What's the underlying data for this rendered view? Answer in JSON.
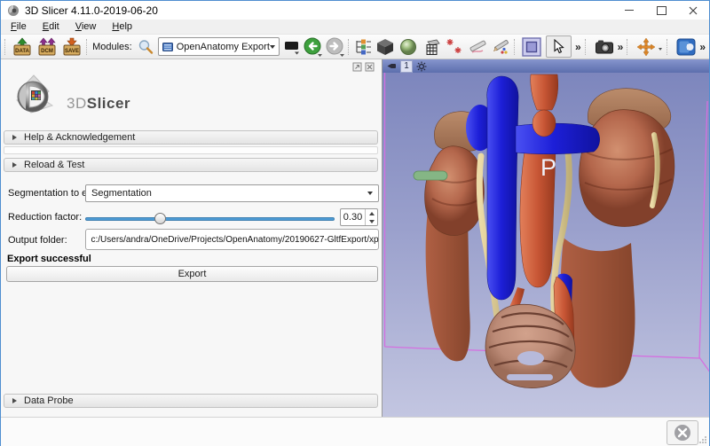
{
  "window": {
    "title": "3D Slicer 4.11.0-2019-06-20"
  },
  "menu": {
    "items": [
      "File",
      "Edit",
      "View",
      "Help"
    ]
  },
  "toolbar": {
    "modules_label": "Modules:",
    "module_value": "OpenAnatomy Export",
    "briefcases": [
      "DATA",
      "DCM",
      "SAVE"
    ],
    "overflow": "»"
  },
  "panel": {
    "logo_prefix": "3D",
    "logo_name": "Slicer",
    "sections": {
      "help": "Help & Acknowledgement",
      "reload": "Reload & Test",
      "data_probe": "Data Probe"
    },
    "form": {
      "segmentation_label": "Segmentation to export:",
      "segmentation_value": "Segmentation",
      "reduction_label": "Reduction factor:",
      "reduction_value": "0.30",
      "output_label": "Output folder:",
      "output_path": "c:/Users/andra/OneDrive/Projects/OpenAnatomy/20190627-GltfExport/xp",
      "status_message": "Export successful",
      "export_button": "Export"
    }
  },
  "view3d": {
    "view_label": "1",
    "orientation_marker": "P"
  },
  "colors": {
    "window_border": "#4f8ed0",
    "slider_accent": "#4d9bd5",
    "view_controller_bar": "#6b7fc0",
    "view_bg_top": "#7d86bd",
    "view_bg_bottom": "#c3c6e1",
    "wireframe_pink": "#d56fe0",
    "kidney": "#b5674c",
    "artery_red": "#cd5a36",
    "vein_blue": "#2b2fe8",
    "ureter_cream": "#e3d7a4",
    "muscle": "#a85a40",
    "bladder": "#c08d7a",
    "marker_green": "#84b584"
  }
}
